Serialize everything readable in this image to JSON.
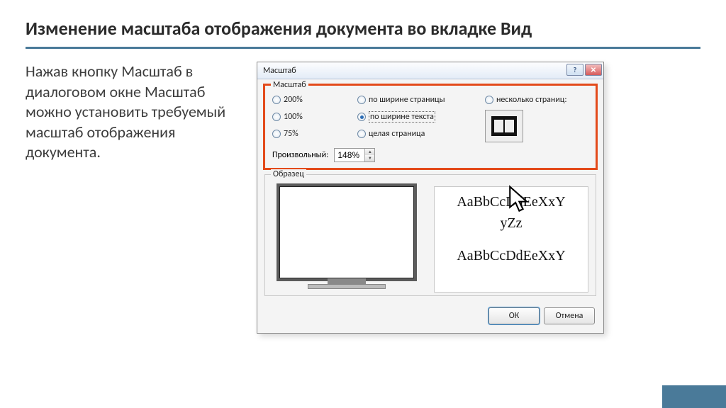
{
  "slide": {
    "heading": "Изменение масштаба отображения документа во вкладке Вид",
    "description": "Нажав кнопку Масштаб в диалоговом окне Масштаб можно установить требуемый масштаб отображения документа."
  },
  "dialog": {
    "title": "Масштаб",
    "help_btn": "?",
    "close_btn": "✕",
    "group_scale": {
      "title": "Масштаб",
      "r200": "200%",
      "r100": "100%",
      "r75": "75%",
      "r_page_width": "по ширине страницы",
      "r_text_width": "по ширине текста",
      "r_whole_page": "целая страница",
      "r_many_pages": "несколько страниц:",
      "custom_label": "Произвольный:",
      "custom_value": "148%",
      "selected": "r_text_width"
    },
    "group_sample": {
      "title": "Образец",
      "sample_line1": "AaBbCcDdEeXxY",
      "sample_line2": "yZz",
      "sample_line3": "AaBbCcDdEeXxY"
    },
    "buttons": {
      "ok": "ОК",
      "cancel": "Отмена"
    }
  }
}
